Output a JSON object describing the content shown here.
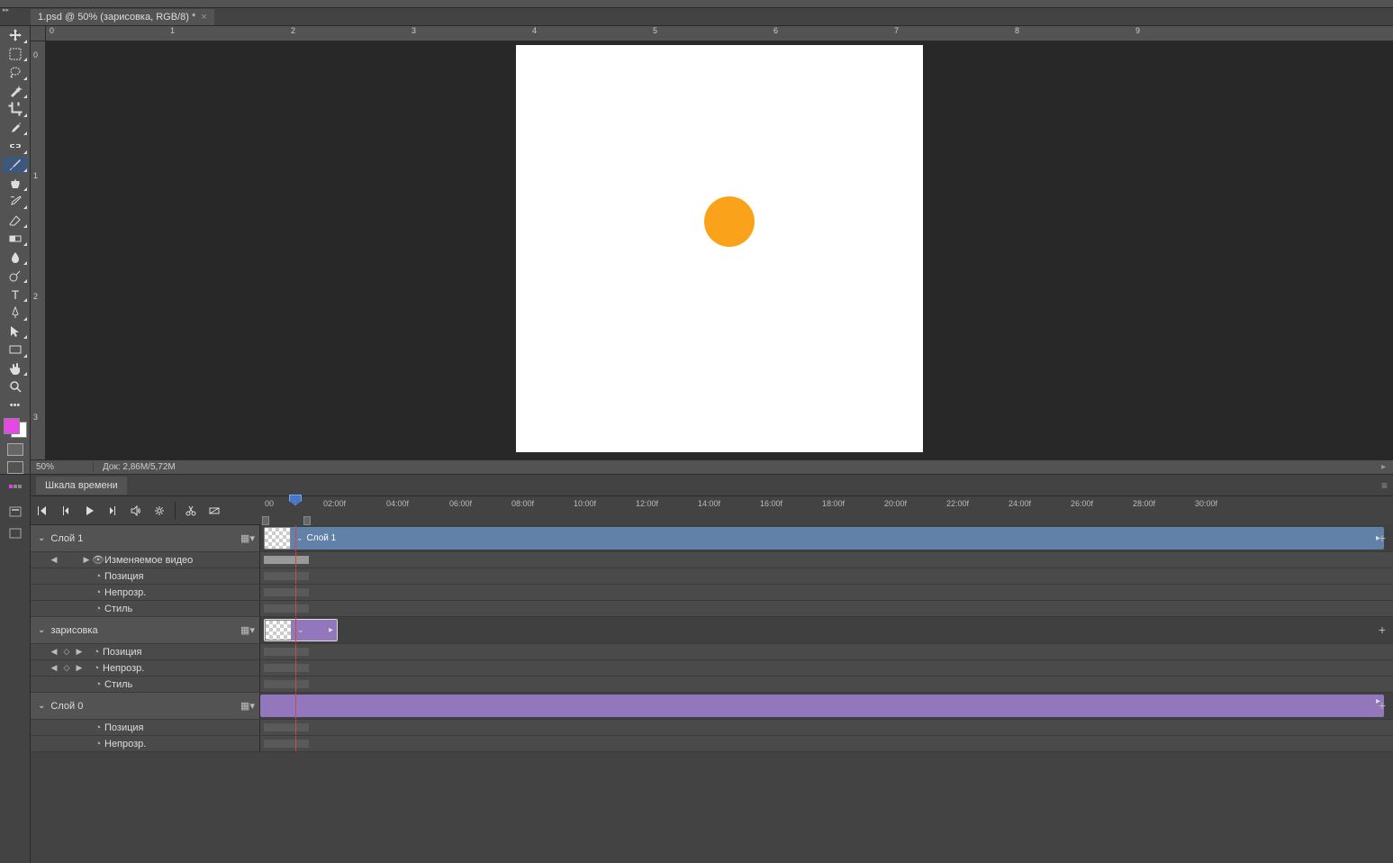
{
  "document": {
    "tab_title": "1.psd @ 50% (зарисовка, RGB/8) *"
  },
  "ruler_h": [
    "0",
    "1",
    "2",
    "3",
    "4",
    "5",
    "6",
    "7",
    "8",
    "9"
  ],
  "ruler_v": [
    "0",
    "1",
    "2",
    "3"
  ],
  "status": {
    "zoom": "50%",
    "doc_info": "Док: 2,86M/5,72M"
  },
  "timeline": {
    "title": "Шкала времени",
    "ruler": [
      "00",
      "02:00f",
      "04:00f",
      "06:00f",
      "08:00f",
      "10:00f",
      "12:00f",
      "14:00f",
      "16:00f",
      "18:00f",
      "20:00f",
      "22:00f",
      "24:00f",
      "26:00f",
      "28:00f",
      "30:00f"
    ],
    "tracks": [
      {
        "name": "Слой 1",
        "props": [
          {
            "label": "Изменяемое видео",
            "has_nav": true
          },
          {
            "label": "Позиция"
          },
          {
            "label": "Непрозр."
          },
          {
            "label": "Стиль"
          }
        ]
      },
      {
        "name": "зарисовка",
        "props": [
          {
            "label": "Позиция",
            "has_keyframes": true
          },
          {
            "label": "Непрозр.",
            "has_keyframes": true
          },
          {
            "label": "Стиль"
          }
        ]
      },
      {
        "name": "Слой 0",
        "props": [
          {
            "label": "Позиция"
          },
          {
            "label": "Непрозр."
          }
        ]
      }
    ]
  }
}
